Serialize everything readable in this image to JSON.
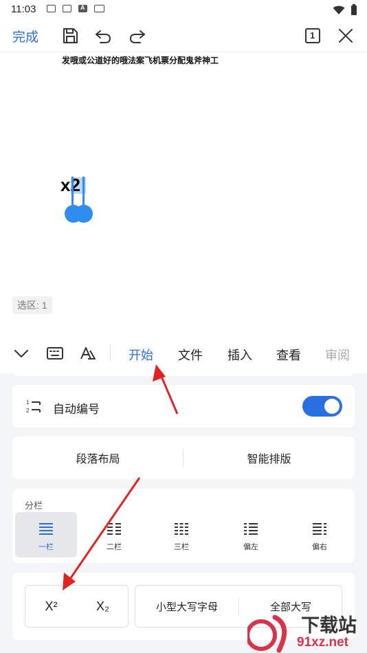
{
  "status": {
    "time": "11:03",
    "icons": [
      "mail-icon",
      "mail-icon",
      "a-app-icon",
      "keyboard-icon"
    ],
    "right_icons": [
      "wifi-icon",
      "battery-icon"
    ]
  },
  "toolbar": {
    "done_label": "完成",
    "page_badge": "1",
    "icons": [
      "save-icon",
      "undo-icon",
      "redo-icon",
      "page-count-icon",
      "close-icon"
    ]
  },
  "document": {
    "line1": "发哦或公道好的哦法案飞机票分配鬼斧神工",
    "selected_text": "x2",
    "selection_count": "选区: 1"
  },
  "panel": {
    "tabs": [
      {
        "label": "开始",
        "active": true
      },
      {
        "label": "文件",
        "active": false
      },
      {
        "label": "插入",
        "active": false
      },
      {
        "label": "查看",
        "active": false
      },
      {
        "label": "审阅",
        "active": false
      }
    ],
    "auto_number": {
      "label": "自动编号",
      "enabled": true
    },
    "layout_buttons": [
      "段落布局",
      "智能排版"
    ],
    "columns": {
      "title": "分栏",
      "options": [
        {
          "label": "一栏",
          "active": true
        },
        {
          "label": "二栏",
          "active": false
        },
        {
          "label": "三栏",
          "active": false
        },
        {
          "label": "偏左",
          "active": false
        },
        {
          "label": "偏右",
          "active": false
        }
      ]
    },
    "script": {
      "superscript_label": "X²",
      "subscript_label": "X₂",
      "small_caps": "小型大写字母",
      "all_caps": "全部大写"
    }
  },
  "watermark": {
    "brand": "下载站",
    "site": "91xz.net"
  },
  "colors": {
    "accent": "#2a6fe0",
    "annotation": "#e02424",
    "watermark": "#d8334a"
  }
}
